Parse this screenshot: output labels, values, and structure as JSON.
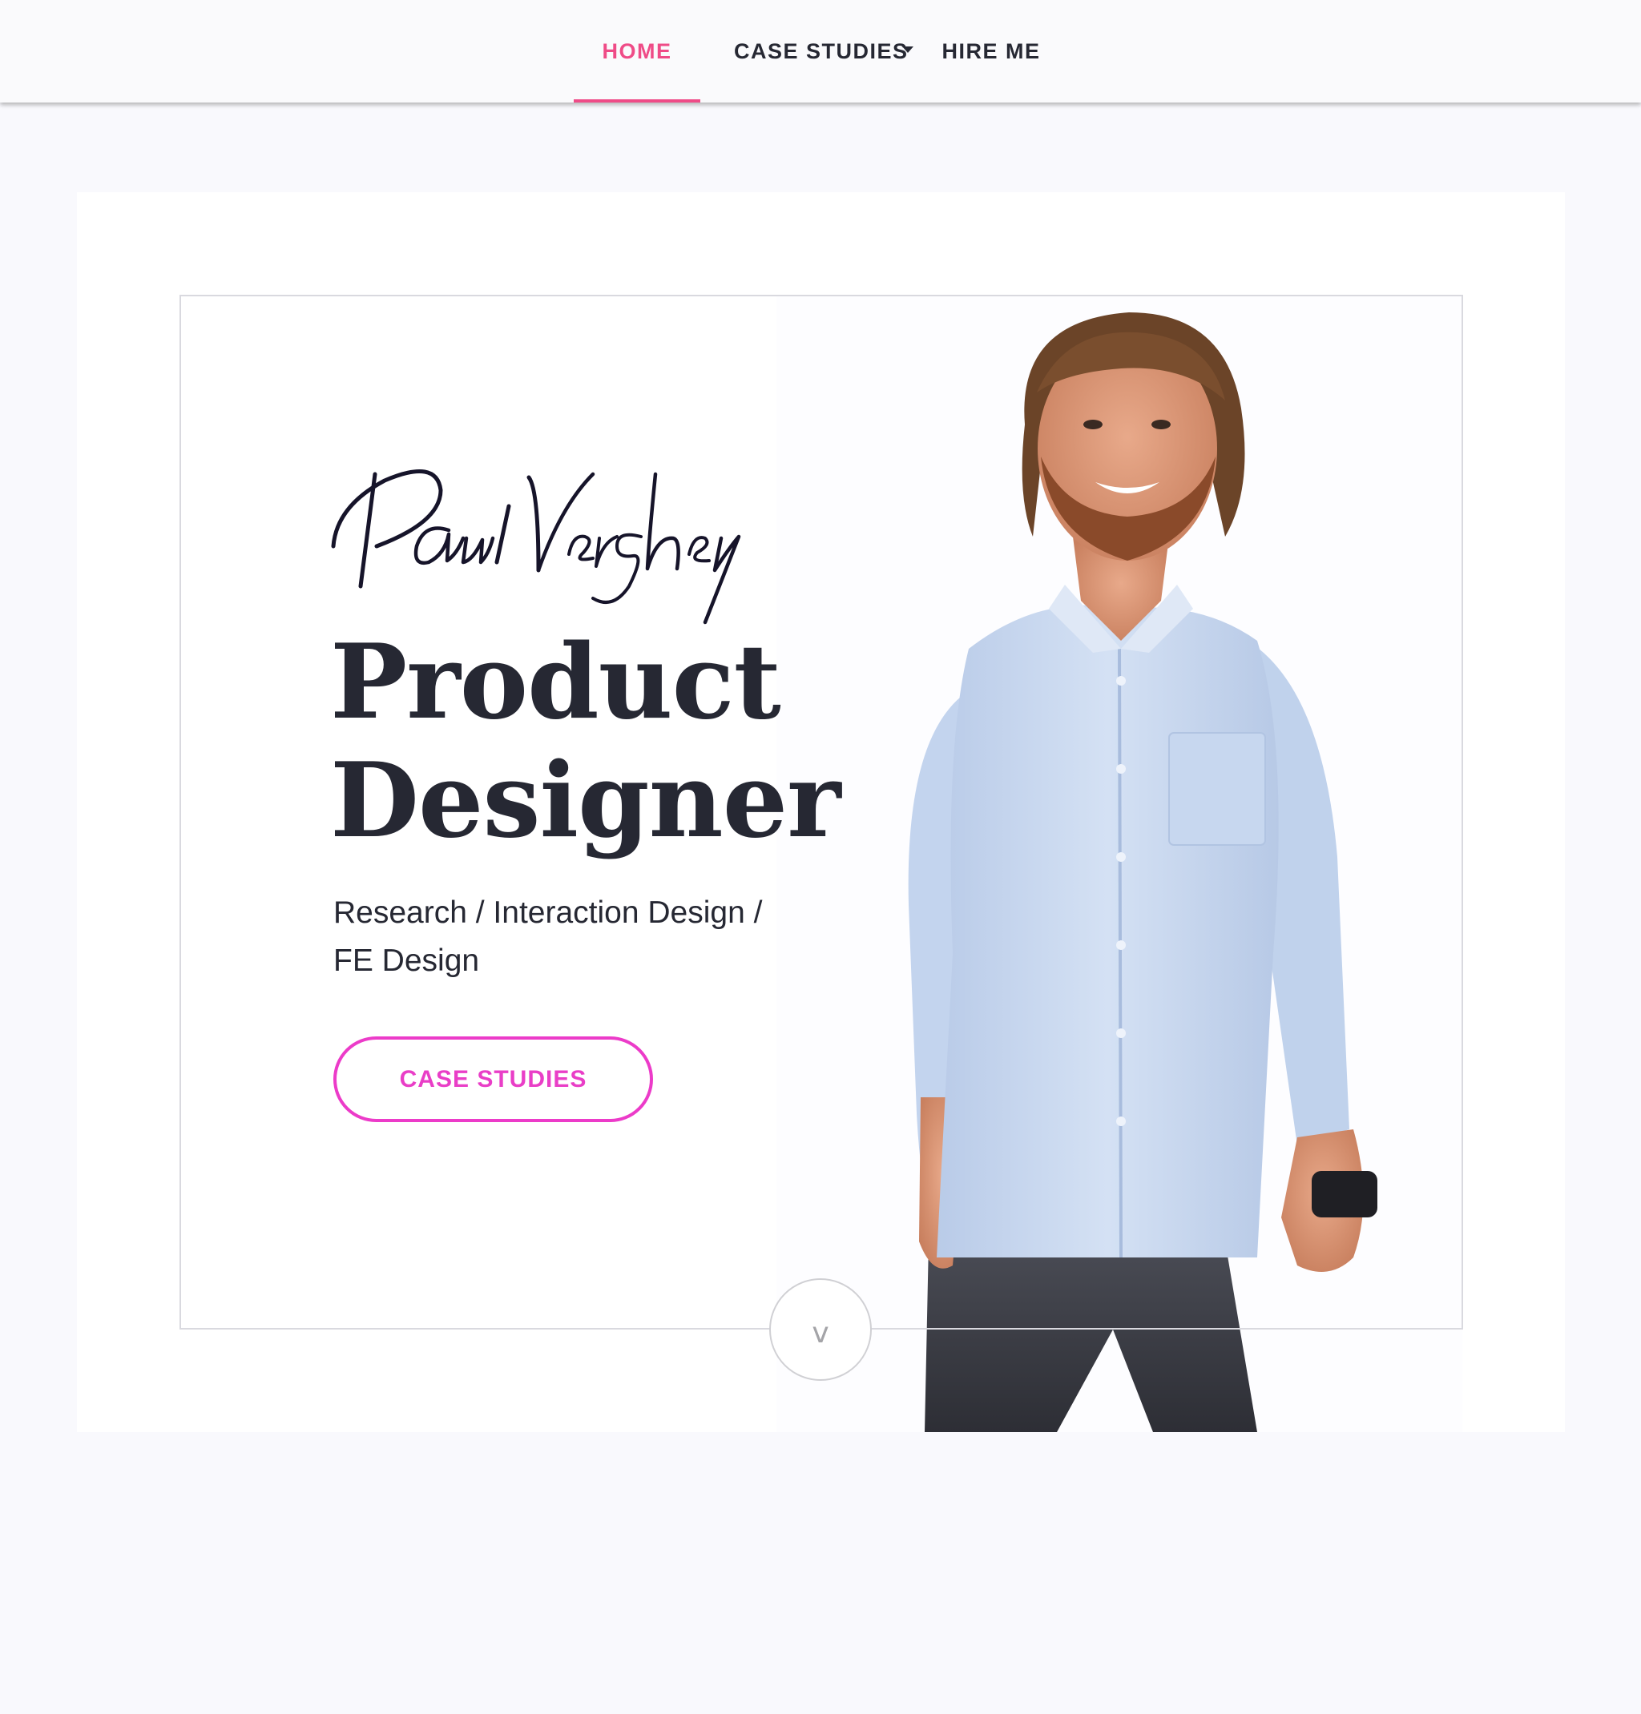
{
  "nav": {
    "home_label": "HOME",
    "case_studies_label": "CASE STUDIES",
    "hire_me_label": "HIRE ME",
    "active": "HOME"
  },
  "hero": {
    "signature_text": "Paul Vershey",
    "title_line1": "Product",
    "title_line2": "Designer",
    "subtitle_line1": "Research / Interaction Design /",
    "subtitle_line2": "FE Design",
    "cta_label": "CASE STUDIES",
    "scroll_icon_text": "v"
  },
  "colors": {
    "accent_pink": "#ef4b87",
    "cta_magenta": "#ec3bc9",
    "text_dark": "#262833",
    "page_bg": "#f9f9fd",
    "shirt_blue": "#c9d9f0"
  },
  "icons": {
    "dropdown": "caret-down-icon",
    "scroll": "chevron-down-icon"
  }
}
